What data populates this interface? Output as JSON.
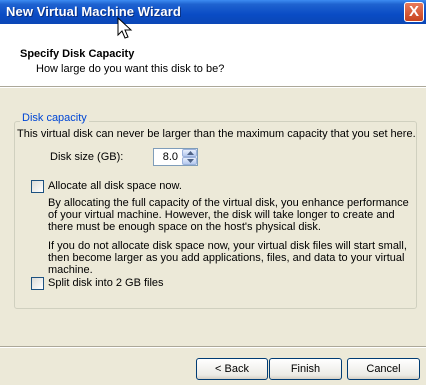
{
  "window": {
    "title": "New Virtual Machine Wizard",
    "close_glyph": "X"
  },
  "header": {
    "title": "Specify Disk Capacity",
    "subtitle": "How large do you want this disk to be?"
  },
  "disk_capacity": {
    "group_label": "Disk capacity",
    "note": "This virtual disk can never be larger than the maximum capacity that you set here.",
    "size_label": "Disk size (GB):",
    "size_value": "8.0"
  },
  "allocate": {
    "label": "Allocate all disk space now.",
    "checked": false,
    "description_1": "By allocating the full capacity of the virtual disk, you enhance performance of your virtual machine.  However, the disk will take longer to create and there must be enough space on the host's physical disk.",
    "description_2": "If you do not allocate disk space now, your virtual disk files will start small, then become larger as you add applications, files, and data to your virtual machine."
  },
  "split": {
    "label": "Split disk into 2 GB files",
    "checked": false
  },
  "buttons": {
    "back": "< Back",
    "finish": "Finish",
    "cancel": "Cancel"
  },
  "icons": {
    "close": "close-icon",
    "cursor": "mouse-cursor-icon",
    "spin_up": "arrow-up-icon",
    "spin_down": "arrow-down-icon"
  },
  "colors": {
    "titlebar": "#0a4cc5",
    "group_label": "#0046d5",
    "face": "#ece9d8"
  }
}
